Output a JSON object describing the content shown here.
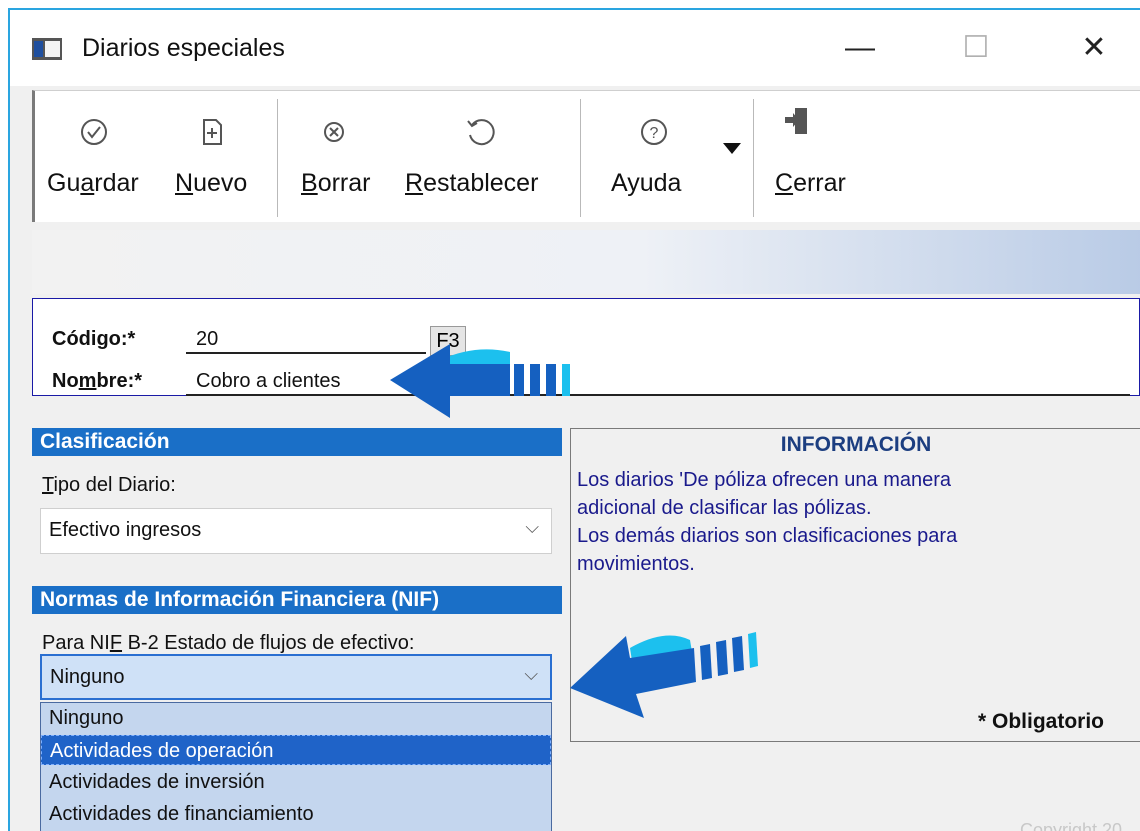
{
  "window": {
    "title": "Diarios especiales",
    "controls": {
      "minimize": "—",
      "maximize": "☐",
      "close": "✕"
    }
  },
  "toolbar": {
    "buttons": [
      {
        "label_pre": "Gu",
        "label_ul": "a",
        "label_post": "rdar",
        "icon": "check-circle-icon"
      },
      {
        "label_pre": "",
        "label_ul": "N",
        "label_post": "uevo",
        "icon": "new-document-icon"
      },
      {
        "label_pre": "",
        "label_ul": "B",
        "label_post": "orrar",
        "icon": "cancel-circle-icon"
      },
      {
        "label_pre": "",
        "label_ul": "R",
        "label_post": "establecer",
        "icon": "undo-icon"
      },
      {
        "label_pre": "Ayuda",
        "label_ul": "",
        "label_post": "",
        "icon": "help-circle-icon"
      },
      {
        "label_pre": "",
        "label_ul": "C",
        "label_post": "errar",
        "icon": "exit-door-icon"
      }
    ]
  },
  "form": {
    "codigo": {
      "label_pre": "Códi",
      "label_ul": "g",
      "label_post": "o:*",
      "value": "20",
      "lookup_key": "F3"
    },
    "nombre": {
      "label_pre": "No",
      "label_ul": "m",
      "label_post": "bre:*",
      "value": "Cobro a clientes"
    }
  },
  "clasificacion": {
    "header": "Clasificación",
    "tipo_label_ul": "T",
    "tipo_label_post": "ipo del Diario:",
    "tipo_value": "Efectivo ingresos"
  },
  "nif": {
    "header": "Normas de Información Financiera (NIF)",
    "label_pre": "Para NI",
    "label_ul": "F",
    "label_post": " B-2 Estado de flujos de efectivo:",
    "value": "Ninguno",
    "options": [
      "Ninguno",
      "Actividades de operación",
      "Actividades de inversión",
      "Actividades de financiamiento"
    ],
    "highlighted_option": "Actividades de operación"
  },
  "info": {
    "title": "INFORMACIÓN",
    "lines": [
      "Los diarios 'De póliza ofrecen una manera",
      "adicional de clasificar las pólizas.",
      "Los demás diarios son clasificaciones para",
      "movimientos."
    ]
  },
  "required_note": "* Obligatorio",
  "copyright": "Copyright 20",
  "colors": {
    "section_header": "#1a6fc7",
    "info_text": "#1a1a8c",
    "arrow_dark": "#1560c0",
    "arrow_light": "#1cc0ee"
  }
}
